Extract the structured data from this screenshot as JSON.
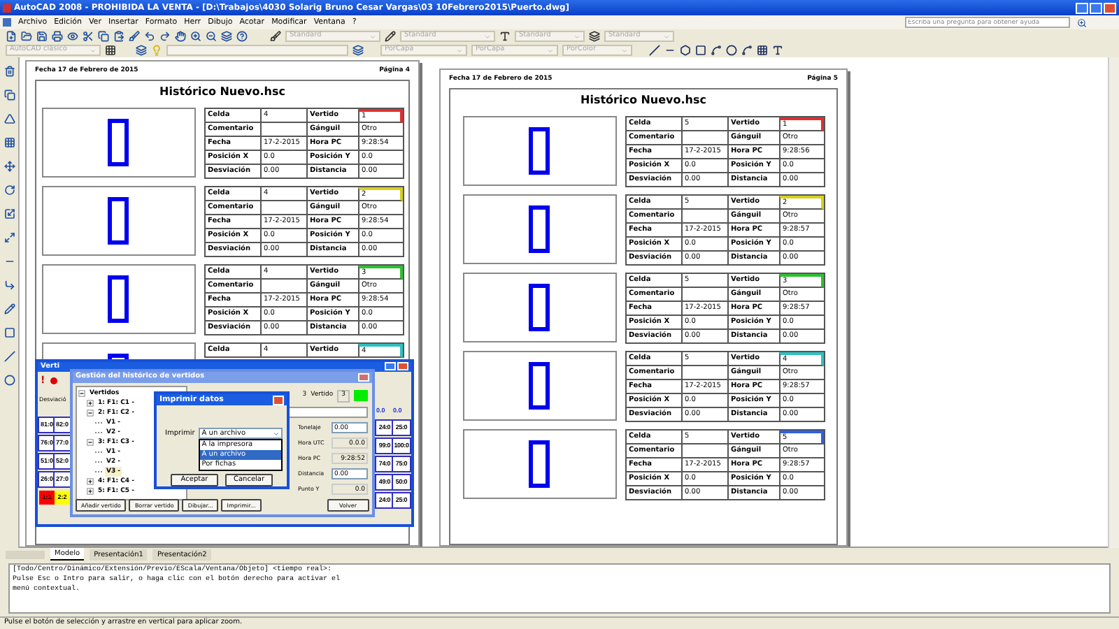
{
  "window": {
    "title": "AutoCAD 2008 - PROHIBIDA LA VENTA - [D:\\Trabajos\\4030 Solarig Bruno Cesar Vargas\\03 10Febrero2015\\Puerto.dwg]"
  },
  "menu": [
    "Archivo",
    "Edición",
    "Ver",
    "Insertar",
    "Formato",
    "Herr",
    "Dibujo",
    "Acotar",
    "Modificar",
    "Ventana",
    "?"
  ],
  "help_search": {
    "placeholder": "Escriba una pregunta para obtener ayuda"
  },
  "toolbar1": {
    "dropdowns": [
      "Standard",
      "Standard",
      "Standard",
      "Standard"
    ]
  },
  "toolbar2": {
    "workspace": "AutoCAD clásico",
    "dropdowns": [
      "PorCapa",
      "PorCapa",
      "PorColor"
    ]
  },
  "pages": [
    {
      "date": "Fecha 17 de Febrero de 2015",
      "page": "Página 4",
      "title": "Histórico Nuevo.hsc",
      "records": [
        {
          "color": "#e03030",
          "rows": [
            [
              "Celda",
              "4",
              "Vertido",
              "1"
            ],
            [
              "Comentario",
              "",
              "Gánguil",
              "Otro"
            ],
            [
              "Fecha",
              "17-2-2015",
              "Hora PC",
              "9:28:54"
            ],
            [
              "Posición X",
              "0.0",
              "Posición Y",
              "0.0"
            ],
            [
              "Desviación",
              "0.00",
              "Distancia",
              "0.00"
            ]
          ]
        },
        {
          "color": "#d8d020",
          "rows": [
            [
              "Celda",
              "4",
              "Vertido",
              "2"
            ],
            [
              "Comentario",
              "",
              "Gánguil",
              "Otro"
            ],
            [
              "Fecha",
              "17-2-2015",
              "Hora PC",
              "9:28:54"
            ],
            [
              "Posición X",
              "0.0",
              "Posición Y",
              "0.0"
            ],
            [
              "Desviación",
              "0.00",
              "Distancia",
              "0.00"
            ]
          ]
        },
        {
          "color": "#30c030",
          "rows": [
            [
              "Celda",
              "4",
              "Vertido",
              "3"
            ],
            [
              "Comentario",
              "",
              "Gánguil",
              "Otro"
            ],
            [
              "Fecha",
              "17-2-2015",
              "Hora PC",
              "9:28:54"
            ],
            [
              "Posición X",
              "0.0",
              "Posición Y",
              "0.0"
            ],
            [
              "Desviación",
              "0.00",
              "Distancia",
              "0.00"
            ]
          ]
        },
        {
          "color": "#30c0c0",
          "rows": [
            [
              "Celda",
              "4",
              "Vertido",
              "4"
            ]
          ]
        }
      ]
    },
    {
      "date": "Fecha 17 de Febrero de 2015",
      "page": "Página 5",
      "title": "Histórico Nuevo.hsc",
      "records": [
        {
          "color": "#e03030",
          "rows": [
            [
              "Celda",
              "5",
              "Vertido",
              "1"
            ],
            [
              "Comentario",
              "",
              "Gánguil",
              "Otro"
            ],
            [
              "Fecha",
              "17-2-2015",
              "Hora PC",
              "9:28:56"
            ],
            [
              "Posición X",
              "0.0",
              "Posición Y",
              "0.0"
            ],
            [
              "Desviación",
              "0.00",
              "Distancia",
              "0.00"
            ]
          ]
        },
        {
          "color": "#d8d020",
          "rows": [
            [
              "Celda",
              "5",
              "Vertido",
              "2"
            ],
            [
              "Comentario",
              "",
              "Gánguil",
              "Otro"
            ],
            [
              "Fecha",
              "17-2-2015",
              "Hora PC",
              "9:28:57"
            ],
            [
              "Posición X",
              "0.0",
              "Posición Y",
              "0.0"
            ],
            [
              "Desviación",
              "0.00",
              "Distancia",
              "0.00"
            ]
          ]
        },
        {
          "color": "#30c030",
          "rows": [
            [
              "Celda",
              "5",
              "Vertido",
              "3"
            ],
            [
              "Comentario",
              "",
              "Gánguil",
              "Otro"
            ],
            [
              "Fecha",
              "17-2-2015",
              "Hora PC",
              "9:28:57"
            ],
            [
              "Posición X",
              "0.0",
              "Posición Y",
              "0.0"
            ],
            [
              "Desviación",
              "0.00",
              "Distancia",
              "0.00"
            ]
          ]
        },
        {
          "color": "#30c0c0",
          "rows": [
            [
              "Celda",
              "5",
              "Vertido",
              "4"
            ],
            [
              "Comentario",
              "",
              "Gánguil",
              "Otro"
            ],
            [
              "Fecha",
              "17-2-2015",
              "Hora PC",
              "9:28:57"
            ],
            [
              "Posición X",
              "0.0",
              "Posición Y",
              "0.0"
            ],
            [
              "Desviación",
              "0.00",
              "Distancia",
              "0.00"
            ]
          ]
        },
        {
          "color": "#3060e0",
          "rows": [
            [
              "Celda",
              "5",
              "Vertido",
              "5"
            ],
            [
              "Comentario",
              "",
              "Gánguil",
              "Otro"
            ],
            [
              "Fecha",
              "17-2-2015",
              "Hora PC",
              "9:28:57"
            ],
            [
              "Posición X",
              "0.0",
              "Posición Y",
              "0.0"
            ],
            [
              "Desviación",
              "0.00",
              "Distancia",
              "0.00"
            ]
          ]
        }
      ]
    }
  ],
  "back_window": {
    "title": "Verti",
    "alert": "!",
    "label": "Desviació",
    "left_rows": [
      {
        "cells": [
          "81:0",
          "82:0"
        ]
      },
      {
        "cells": [
          "76:0",
          "77:0"
        ]
      },
      {
        "cells": [
          "51:0",
          "52:0"
        ]
      },
      {
        "cells": [
          "26:0",
          "27:0"
        ]
      }
    ],
    "swatches": [
      {
        "text": "1:1",
        "color": "#ff0000"
      },
      {
        "text": "2:2",
        "color": "#ffff00"
      }
    ],
    "right_header": [
      "0.0",
      "0.0"
    ],
    "right_rows": [
      {
        "cells": [
          "24:0",
          "25:0"
        ]
      },
      {
        "cells": [
          "99:0",
          "100:0"
        ]
      },
      {
        "cells": [
          "74:0",
          "75:0"
        ]
      },
      {
        "cells": [
          "49:0",
          "50:0"
        ]
      },
      {
        "cells": [
          "24:0",
          "25:0"
        ]
      }
    ]
  },
  "manager": {
    "title": "Gestión del histórico de vertidos",
    "tree": [
      {
        "label": "Vertidos",
        "expanded": true,
        "children": [
          {
            "label": "1: F1: C1 -",
            "expanded": false,
            "selected": false
          },
          {
            "label": "2: F1: C2 -",
            "expanded": true,
            "selected": false,
            "children": [
              {
                "label": "V1 -",
                "selected": false
              },
              {
                "label": "V2 -",
                "selected": false
              }
            ]
          },
          {
            "label": "3: F1: C3 -",
            "expanded": true,
            "selected": false,
            "children": [
              {
                "label": "V1 -",
                "selected": false
              },
              {
                "label": "V2 -",
                "selected": false
              },
              {
                "label": "V3 -",
                "selected": true
              }
            ]
          },
          {
            "label": "4: F1: C4 -",
            "expanded": false,
            "selected": false
          },
          {
            "label": "5: F1: C5 -",
            "expanded": false,
            "selected": false
          }
        ]
      }
    ],
    "header": {
      "celda": "3",
      "label": "Vertido",
      "value": "3",
      "color": "#00ee00"
    },
    "fields": [
      {
        "label": "Tonelaje",
        "value": "0.00",
        "editable": true
      },
      {
        "label": "Hora UTC",
        "value": "0.0.0",
        "editable": false
      },
      {
        "label": "Hora PC",
        "value": "9:28:52",
        "editable": false
      },
      {
        "label": "Distancia",
        "value": "0.00",
        "editable": true
      },
      {
        "label": "Punto Y",
        "value": "0.0",
        "editable": false
      }
    ],
    "buttons": [
      "Añadir vertido",
      "Borrar vertido",
      "Dibujar...",
      "Imprimir..."
    ],
    "close_button": "Volver"
  },
  "print_dialog": {
    "title": "Imprimir datos",
    "label": "Imprimir",
    "value": "A un archivo",
    "options": [
      {
        "label": "A la impresora",
        "selected": false
      },
      {
        "label": "A un archivo",
        "selected": true
      },
      {
        "label": "Por fichas",
        "selected": false
      }
    ],
    "buttons": [
      "Aceptar",
      "Cancelar"
    ]
  },
  "tabs": [
    {
      "label": "Modelo",
      "selected": true
    },
    {
      "label": "Presentación1",
      "selected": false
    },
    {
      "label": "Presentación2",
      "selected": false
    }
  ],
  "command_lines": [
    "[Todo/Centro/Dinámico/Extensión/Previo/EScala/Ventana/Objeto] <tiempo real>:",
    "Pulse Esc o Intro para salir, o haga clic con el botón derecho para activar el",
    "menú contextual."
  ],
  "status_bar": "Pulse el botón de selección y arrastre en vertical para aplicar zoom."
}
